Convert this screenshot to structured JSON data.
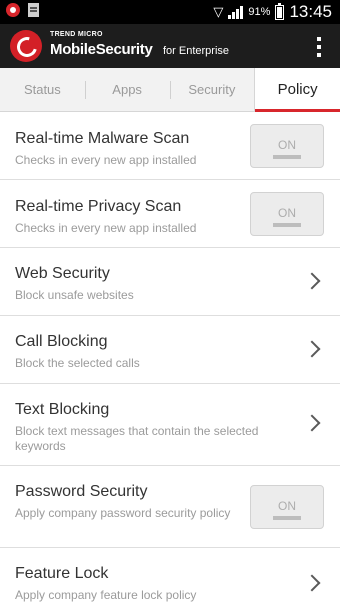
{
  "status_bar": {
    "battery_percent": "91%",
    "time": "13:45"
  },
  "app": {
    "brand_small": "TREND MICRO",
    "brand_main": "MobileSecurity",
    "brand_sub": "for Enterprise"
  },
  "tabs": [
    {
      "label": "Status",
      "active": false
    },
    {
      "label": "Apps",
      "active": false
    },
    {
      "label": "Security",
      "active": false
    },
    {
      "label": "Policy",
      "active": true
    }
  ],
  "items": [
    {
      "title": "Real-time Malware Scan",
      "description": "Checks in every new app installed",
      "control": "toggle",
      "toggle_label": "ON"
    },
    {
      "title": "Real-time Privacy Scan",
      "description": "Checks in every new app installed",
      "control": "toggle",
      "toggle_label": "ON"
    },
    {
      "title": "Web Security",
      "description": "Block unsafe websites",
      "control": "chevron"
    },
    {
      "title": "Call Blocking",
      "description": "Block the selected calls",
      "control": "chevron"
    },
    {
      "title": "Text Blocking",
      "description": "Block text messages that contain the selected keywords",
      "control": "chevron"
    },
    {
      "title": "Password Security",
      "description": "Apply company password security policy",
      "control": "toggle",
      "toggle_label": "ON"
    },
    {
      "title": "Feature Lock",
      "description": "Apply company feature lock policy",
      "control": "chevron"
    }
  ],
  "colors": {
    "accent": "#d8262c",
    "appbar": "#1d1d1d"
  }
}
